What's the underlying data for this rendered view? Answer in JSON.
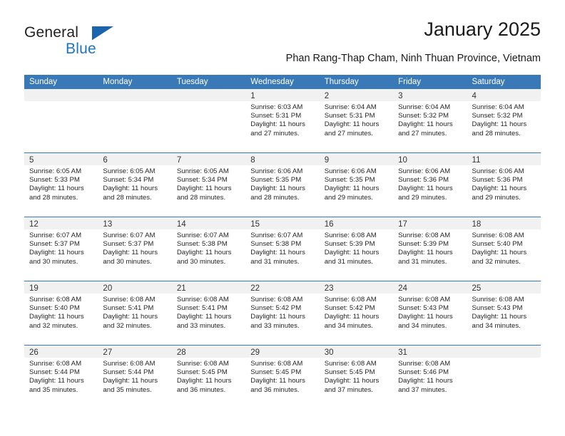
{
  "brand": {
    "name_part1": "General",
    "name_part2": "Blue",
    "triangle_icon": "brand-triangle-icon",
    "color_dark": "#231f20",
    "color_blue": "#1b74c4"
  },
  "header": {
    "title": "January 2025",
    "subtitle": "Phan Rang-Thap Cham, Ninh Thuan Province, Vietnam"
  },
  "theme": {
    "header_bg": "#3a79b8",
    "cell_head_bg": "#f1f1f1",
    "grid_line": "#3a79b8"
  },
  "weekdays": [
    "Sunday",
    "Monday",
    "Tuesday",
    "Wednesday",
    "Thursday",
    "Friday",
    "Saturday"
  ],
  "weeks": [
    [
      {
        "day": "",
        "empty": true
      },
      {
        "day": "",
        "empty": true
      },
      {
        "day": "",
        "empty": true
      },
      {
        "day": "1",
        "sunrise": "Sunrise: 6:03 AM",
        "sunset": "Sunset: 5:31 PM",
        "daylight1": "Daylight: 11 hours",
        "daylight2": "and 27 minutes."
      },
      {
        "day": "2",
        "sunrise": "Sunrise: 6:04 AM",
        "sunset": "Sunset: 5:31 PM",
        "daylight1": "Daylight: 11 hours",
        "daylight2": "and 27 minutes."
      },
      {
        "day": "3",
        "sunrise": "Sunrise: 6:04 AM",
        "sunset": "Sunset: 5:32 PM",
        "daylight1": "Daylight: 11 hours",
        "daylight2": "and 27 minutes."
      },
      {
        "day": "4",
        "sunrise": "Sunrise: 6:04 AM",
        "sunset": "Sunset: 5:32 PM",
        "daylight1": "Daylight: 11 hours",
        "daylight2": "and 28 minutes."
      }
    ],
    [
      {
        "day": "5",
        "sunrise": "Sunrise: 6:05 AM",
        "sunset": "Sunset: 5:33 PM",
        "daylight1": "Daylight: 11 hours",
        "daylight2": "and 28 minutes."
      },
      {
        "day": "6",
        "sunrise": "Sunrise: 6:05 AM",
        "sunset": "Sunset: 5:34 PM",
        "daylight1": "Daylight: 11 hours",
        "daylight2": "and 28 minutes."
      },
      {
        "day": "7",
        "sunrise": "Sunrise: 6:05 AM",
        "sunset": "Sunset: 5:34 PM",
        "daylight1": "Daylight: 11 hours",
        "daylight2": "and 28 minutes."
      },
      {
        "day": "8",
        "sunrise": "Sunrise: 6:06 AM",
        "sunset": "Sunset: 5:35 PM",
        "daylight1": "Daylight: 11 hours",
        "daylight2": "and 28 minutes."
      },
      {
        "day": "9",
        "sunrise": "Sunrise: 6:06 AM",
        "sunset": "Sunset: 5:35 PM",
        "daylight1": "Daylight: 11 hours",
        "daylight2": "and 29 minutes."
      },
      {
        "day": "10",
        "sunrise": "Sunrise: 6:06 AM",
        "sunset": "Sunset: 5:36 PM",
        "daylight1": "Daylight: 11 hours",
        "daylight2": "and 29 minutes."
      },
      {
        "day": "11",
        "sunrise": "Sunrise: 6:06 AM",
        "sunset": "Sunset: 5:36 PM",
        "daylight1": "Daylight: 11 hours",
        "daylight2": "and 29 minutes."
      }
    ],
    [
      {
        "day": "12",
        "sunrise": "Sunrise: 6:07 AM",
        "sunset": "Sunset: 5:37 PM",
        "daylight1": "Daylight: 11 hours",
        "daylight2": "and 30 minutes."
      },
      {
        "day": "13",
        "sunrise": "Sunrise: 6:07 AM",
        "sunset": "Sunset: 5:37 PM",
        "daylight1": "Daylight: 11 hours",
        "daylight2": "and 30 minutes."
      },
      {
        "day": "14",
        "sunrise": "Sunrise: 6:07 AM",
        "sunset": "Sunset: 5:38 PM",
        "daylight1": "Daylight: 11 hours",
        "daylight2": "and 30 minutes."
      },
      {
        "day": "15",
        "sunrise": "Sunrise: 6:07 AM",
        "sunset": "Sunset: 5:38 PM",
        "daylight1": "Daylight: 11 hours",
        "daylight2": "and 31 minutes."
      },
      {
        "day": "16",
        "sunrise": "Sunrise: 6:08 AM",
        "sunset": "Sunset: 5:39 PM",
        "daylight1": "Daylight: 11 hours",
        "daylight2": "and 31 minutes."
      },
      {
        "day": "17",
        "sunrise": "Sunrise: 6:08 AM",
        "sunset": "Sunset: 5:39 PM",
        "daylight1": "Daylight: 11 hours",
        "daylight2": "and 31 minutes."
      },
      {
        "day": "18",
        "sunrise": "Sunrise: 6:08 AM",
        "sunset": "Sunset: 5:40 PM",
        "daylight1": "Daylight: 11 hours",
        "daylight2": "and 32 minutes."
      }
    ],
    [
      {
        "day": "19",
        "sunrise": "Sunrise: 6:08 AM",
        "sunset": "Sunset: 5:40 PM",
        "daylight1": "Daylight: 11 hours",
        "daylight2": "and 32 minutes."
      },
      {
        "day": "20",
        "sunrise": "Sunrise: 6:08 AM",
        "sunset": "Sunset: 5:41 PM",
        "daylight1": "Daylight: 11 hours",
        "daylight2": "and 32 minutes."
      },
      {
        "day": "21",
        "sunrise": "Sunrise: 6:08 AM",
        "sunset": "Sunset: 5:41 PM",
        "daylight1": "Daylight: 11 hours",
        "daylight2": "and 33 minutes."
      },
      {
        "day": "22",
        "sunrise": "Sunrise: 6:08 AM",
        "sunset": "Sunset: 5:42 PM",
        "daylight1": "Daylight: 11 hours",
        "daylight2": "and 33 minutes."
      },
      {
        "day": "23",
        "sunrise": "Sunrise: 6:08 AM",
        "sunset": "Sunset: 5:42 PM",
        "daylight1": "Daylight: 11 hours",
        "daylight2": "and 34 minutes."
      },
      {
        "day": "24",
        "sunrise": "Sunrise: 6:08 AM",
        "sunset": "Sunset: 5:43 PM",
        "daylight1": "Daylight: 11 hours",
        "daylight2": "and 34 minutes."
      },
      {
        "day": "25",
        "sunrise": "Sunrise: 6:08 AM",
        "sunset": "Sunset: 5:43 PM",
        "daylight1": "Daylight: 11 hours",
        "daylight2": "and 34 minutes."
      }
    ],
    [
      {
        "day": "26",
        "sunrise": "Sunrise: 6:08 AM",
        "sunset": "Sunset: 5:44 PM",
        "daylight1": "Daylight: 11 hours",
        "daylight2": "and 35 minutes."
      },
      {
        "day": "27",
        "sunrise": "Sunrise: 6:08 AM",
        "sunset": "Sunset: 5:44 PM",
        "daylight1": "Daylight: 11 hours",
        "daylight2": "and 35 minutes."
      },
      {
        "day": "28",
        "sunrise": "Sunrise: 6:08 AM",
        "sunset": "Sunset: 5:45 PM",
        "daylight1": "Daylight: 11 hours",
        "daylight2": "and 36 minutes."
      },
      {
        "day": "29",
        "sunrise": "Sunrise: 6:08 AM",
        "sunset": "Sunset: 5:45 PM",
        "daylight1": "Daylight: 11 hours",
        "daylight2": "and 36 minutes."
      },
      {
        "day": "30",
        "sunrise": "Sunrise: 6:08 AM",
        "sunset": "Sunset: 5:45 PM",
        "daylight1": "Daylight: 11 hours",
        "daylight2": "and 37 minutes."
      },
      {
        "day": "31",
        "sunrise": "Sunrise: 6:08 AM",
        "sunset": "Sunset: 5:46 PM",
        "daylight1": "Daylight: 11 hours",
        "daylight2": "and 37 minutes."
      },
      {
        "day": "",
        "empty": true
      }
    ]
  ]
}
